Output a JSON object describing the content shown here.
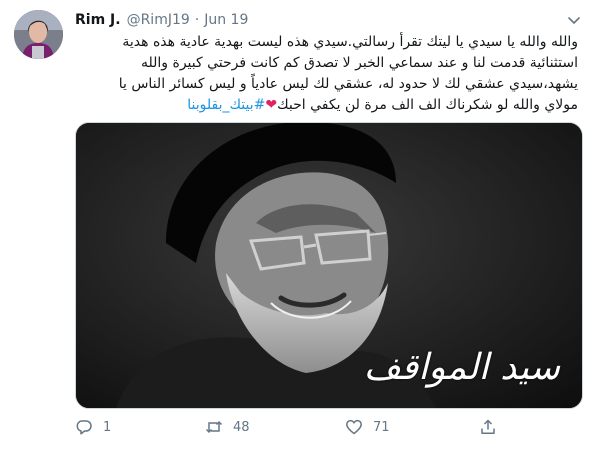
{
  "tweet": {
    "author_name": "Rim J.",
    "author_handle": "@RimJ19",
    "separator": "·",
    "date": "Jun 19",
    "text_lines": [
      "والله والله يا سيدي يا ليتك تقرأ رسالتي.سيدي هذه ليست بهدية عادية هذه هدية",
      "استثنائية قدمت لنا و عند سماعي الخبر لا تصدق كم كانت فرحتي كبيرة والله",
      "يشهد،سيدي عشقي لك لا حدود له، عشقي لك ليس عادياً و ليس كسائر الناس يا",
      "مولاي والله لو شكرناك الف الف مرة لن يكفي احبك"
    ],
    "heart_emoji": "❤",
    "hashtag": "#بيتك_بقلوبنا",
    "image_caption": "سيد المواقف",
    "icons": {
      "more": "chevron-down-icon",
      "reply": "reply-icon",
      "retweet": "retweet-icon",
      "like": "heart-icon",
      "share": "share-icon"
    },
    "counts": {
      "replies": "1",
      "retweets": "48",
      "likes": "71"
    },
    "colors": {
      "link": "#1b95e0",
      "muted": "#657786",
      "heart": "#e0245e"
    }
  }
}
